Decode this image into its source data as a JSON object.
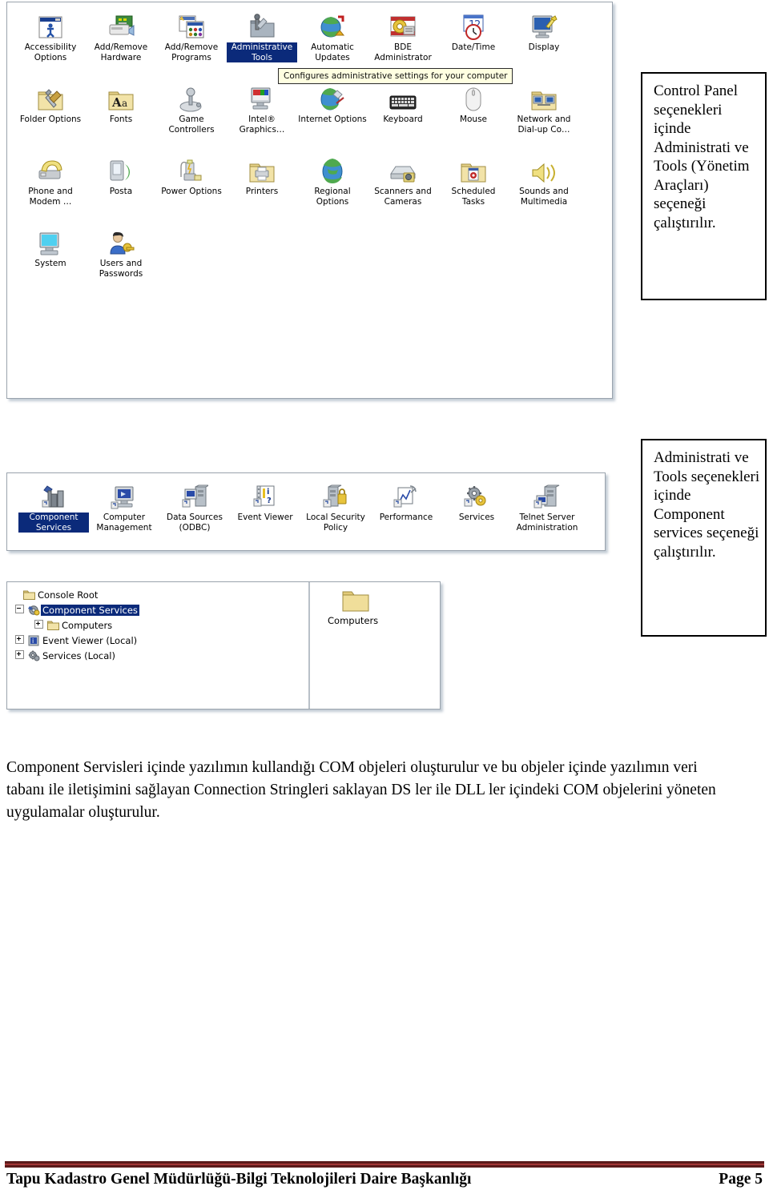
{
  "document": {
    "page_label": "Page 5",
    "footer_text": "Tapu Kadastro Genel Müdürlüğü-Bilgi Teknolojileri Daire Başkanlığı",
    "body_paragraph": "Component Servisleri içinde yazılımın kullandığı COM objeleri oluşturulur ve bu objeler içinde yazılımın veri tabanı ile iletişimini sağlayan Connection Stringleri saklayan DS ler ile DLL ler içindeki COM objelerini yöneten uygulamalar oluşturulur.",
    "footer_rule_color": "#5b1a1a",
    "footer_rule_inner_color": "#a33636"
  },
  "callouts": [
    {
      "id": "callout-1",
      "text": "Control Panel seçenekleri içinde Administrati ve Tools (Yönetim Araçları) seçeneği çalıştırılır."
    },
    {
      "id": "callout-2",
      "text": "Administrati ve Tools seçenekleri içinde Component services seçeneği çalıştırılır."
    }
  ],
  "control_panel": {
    "selection_color": "#0b2a7a",
    "tooltip": "Configures administrative settings for your computer",
    "rows": [
      [
        {
          "label": "Accessibility Options",
          "icon": "accessibility-icon",
          "selected": false
        },
        {
          "label": "Add/Remove Hardware",
          "icon": "add-remove-hardware-icon",
          "selected": false
        },
        {
          "label": "Add/Remove Programs",
          "icon": "add-remove-programs-icon",
          "selected": false
        },
        {
          "label": "Administrative Tools",
          "icon": "administrative-tools-icon",
          "selected": true
        },
        {
          "label": "Automatic Updates",
          "icon": "automatic-updates-icon",
          "selected": false
        },
        {
          "label": "BDE Administrator",
          "icon": "bde-administrator-icon",
          "selected": false
        },
        {
          "label": "Date/Time",
          "icon": "date-time-icon",
          "selected": false
        },
        {
          "label": "Display",
          "icon": "display-icon",
          "selected": false
        }
      ],
      [
        {
          "label": "Folder Options",
          "icon": "folder-options-icon",
          "selected": false
        },
        {
          "label": "Fonts",
          "icon": "fonts-icon",
          "selected": false
        },
        {
          "label": "Game Controllers",
          "icon": "game-controllers-icon",
          "selected": false
        },
        {
          "label": "Intel® Graphics…",
          "icon": "intel-graphics-icon",
          "selected": false
        },
        {
          "label": "Internet Options",
          "icon": "internet-options-icon",
          "selected": false
        },
        {
          "label": "Keyboard",
          "icon": "keyboard-icon",
          "selected": false
        },
        {
          "label": "Mouse",
          "icon": "mouse-icon",
          "selected": false
        },
        {
          "label": "Network and Dial-up Co…",
          "icon": "network-dialup-icon",
          "selected": false
        }
      ],
      [
        {
          "label": "Phone and Modem …",
          "icon": "phone-modem-icon",
          "selected": false
        },
        {
          "label": "Posta",
          "icon": "posta-icon",
          "selected": false
        },
        {
          "label": "Power Options",
          "icon": "power-options-icon",
          "selected": false
        },
        {
          "label": "Printers",
          "icon": "printers-icon",
          "selected": false
        },
        {
          "label": "Regional Options",
          "icon": "regional-options-icon",
          "selected": false
        },
        {
          "label": "Scanners and Cameras",
          "icon": "scanners-cameras-icon",
          "selected": false
        },
        {
          "label": "Scheduled Tasks",
          "icon": "scheduled-tasks-icon",
          "selected": false
        },
        {
          "label": "Sounds and Multimedia",
          "icon": "sounds-multimedia-icon",
          "selected": false
        }
      ],
      [
        {
          "label": "System",
          "icon": "system-icon",
          "selected": false
        },
        {
          "label": "Users and Passwords",
          "icon": "users-passwords-icon",
          "selected": false
        }
      ]
    ]
  },
  "administrative_tools": {
    "items": [
      {
        "label": "Component Services",
        "icon": "component-services-icon",
        "selected": true
      },
      {
        "label": "Computer Management",
        "icon": "computer-management-icon",
        "selected": false
      },
      {
        "label": "Data Sources (ODBC)",
        "icon": "data-sources-odbc-icon",
        "selected": false
      },
      {
        "label": "Event Viewer",
        "icon": "event-viewer-icon",
        "selected": false
      },
      {
        "label": "Local Security Policy",
        "icon": "local-security-policy-icon",
        "selected": false
      },
      {
        "label": "Performance",
        "icon": "performance-icon",
        "selected": false
      },
      {
        "label": "Services",
        "icon": "services-icon",
        "selected": false
      },
      {
        "label": "Telnet Server Administration",
        "icon": "telnet-server-administration-icon",
        "selected": false
      }
    ]
  },
  "mmc_console": {
    "tree": [
      {
        "label": "Console Root",
        "indent": 0,
        "expander": "none",
        "icon": "folder-icon",
        "selected": false
      },
      {
        "label": "Component Services",
        "indent": 1,
        "expander": "minus",
        "icon": "component-services-small-icon",
        "selected": true
      },
      {
        "label": "Computers",
        "indent": 2,
        "expander": "plus",
        "icon": "folder-icon",
        "selected": false
      },
      {
        "label": "Event Viewer (Local)",
        "indent": 1,
        "expander": "plus",
        "icon": "event-viewer-small-icon",
        "selected": false
      },
      {
        "label": "Services (Local)",
        "indent": 1,
        "expander": "plus",
        "icon": "services-small-icon",
        "selected": false
      }
    ],
    "detail": {
      "label": "Computers",
      "icon": "folder-icon"
    }
  }
}
